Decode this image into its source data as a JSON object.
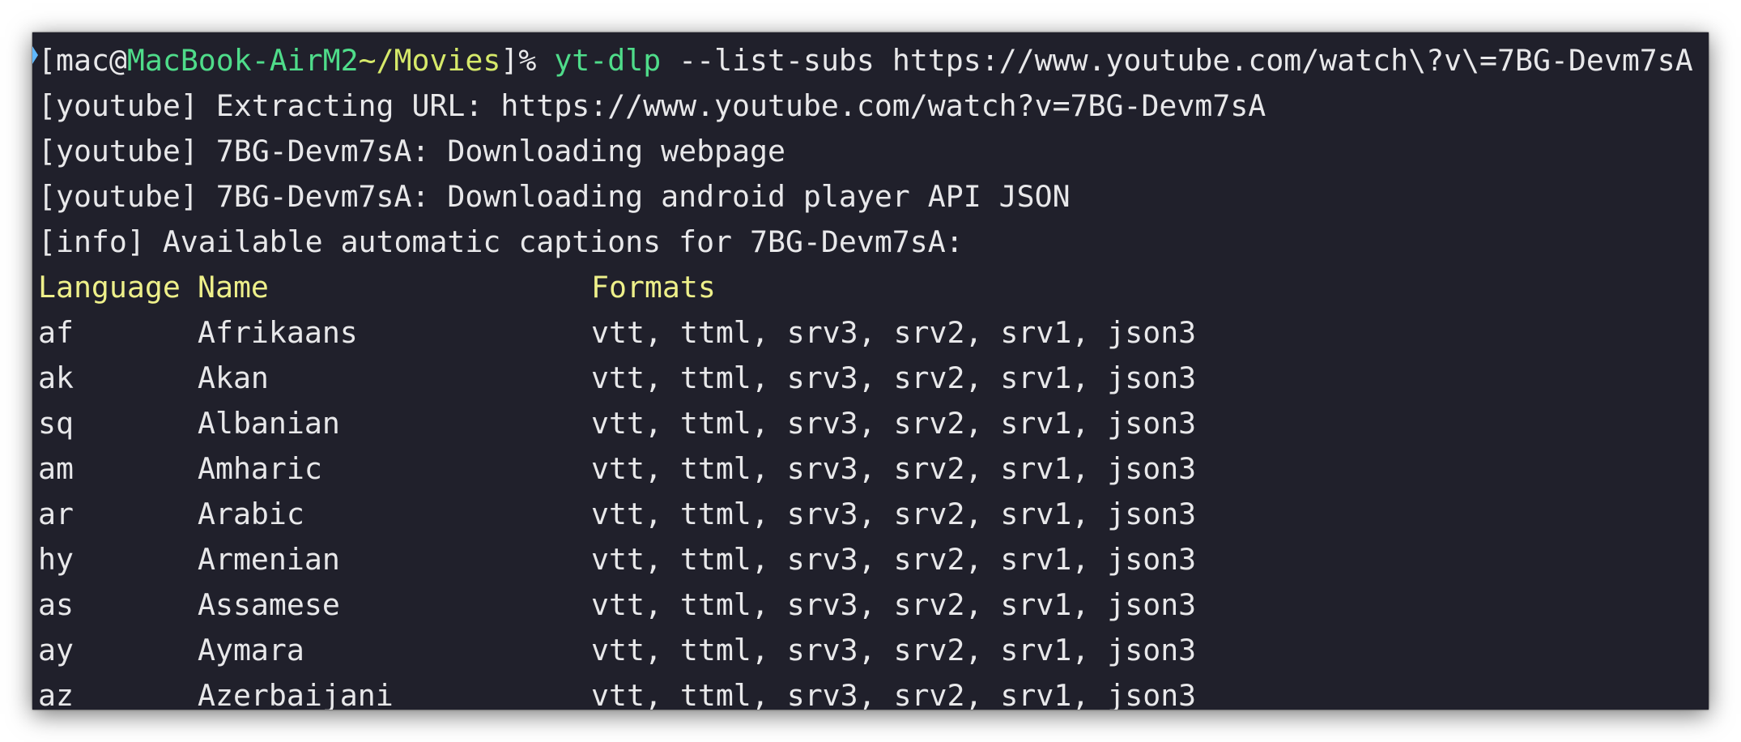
{
  "prompt": {
    "bracket_open": "[",
    "user": "mac@",
    "host": "MacBook-AirM2",
    "path": "~/Movies",
    "bracket_close": "]",
    "symbol": "% ",
    "command": "yt-dlp",
    "args": " --list-subs https://www.youtube.com/watch\\?v\\=7BG-Devm7sA"
  },
  "output": [
    "[youtube] Extracting URL: https://www.youtube.com/watch?v=7BG-Devm7sA",
    "[youtube] 7BG-Devm7sA: Downloading webpage",
    "[youtube] 7BG-Devm7sA: Downloading android player API JSON",
    "[info] Available automatic captions for 7BG-Devm7sA:"
  ],
  "table": {
    "headers": {
      "language": "Language",
      "name": "Name",
      "formats": "Formats"
    },
    "rows": [
      {
        "code": "af",
        "name": "Afrikaans",
        "formats": "vtt, ttml, srv3, srv2, srv1, json3"
      },
      {
        "code": "ak",
        "name": "Akan",
        "formats": "vtt, ttml, srv3, srv2, srv1, json3"
      },
      {
        "code": "sq",
        "name": "Albanian",
        "formats": "vtt, ttml, srv3, srv2, srv1, json3"
      },
      {
        "code": "am",
        "name": "Amharic",
        "formats": "vtt, ttml, srv3, srv2, srv1, json3"
      },
      {
        "code": "ar",
        "name": "Arabic",
        "formats": "vtt, ttml, srv3, srv2, srv1, json3"
      },
      {
        "code": "hy",
        "name": "Armenian",
        "formats": "vtt, ttml, srv3, srv2, srv1, json3"
      },
      {
        "code": "as",
        "name": "Assamese",
        "formats": "vtt, ttml, srv3, srv2, srv1, json3"
      },
      {
        "code": "ay",
        "name": "Aymara",
        "formats": "vtt, ttml, srv3, srv2, srv1, json3"
      },
      {
        "code": "az",
        "name": "Azerbaijani",
        "formats": "vtt, ttml, srv3, srv2, srv1, json3"
      }
    ]
  },
  "colors": {
    "background": "#20202b",
    "text": "#e8e8ea",
    "host": "#4fdc8a",
    "path": "#d6e96a",
    "command": "#4fdc8a",
    "header": "#eef08a",
    "marker": "#5fb8ff"
  },
  "icons": {
    "prompt_marker": "prompt-marker-icon"
  }
}
